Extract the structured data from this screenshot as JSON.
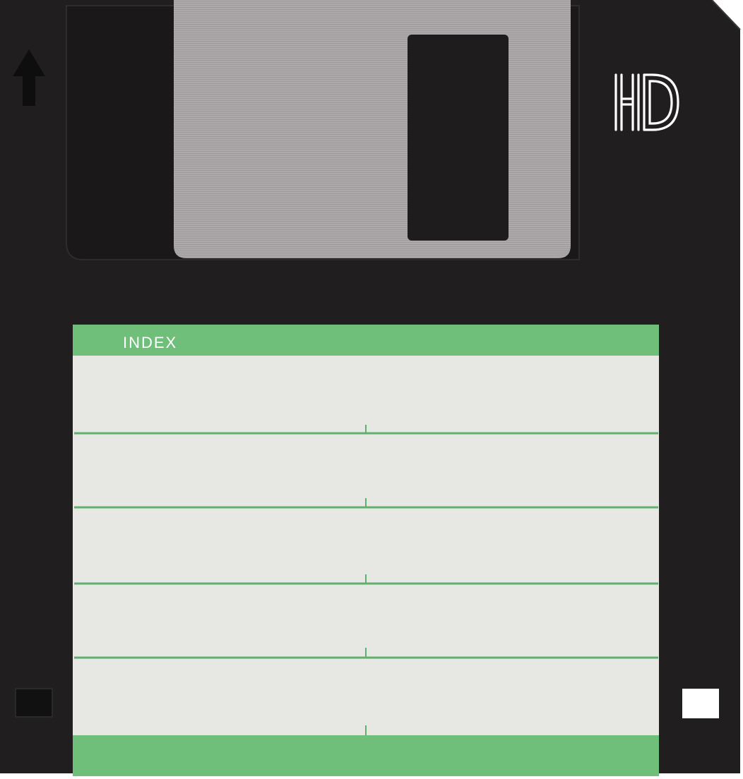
{
  "object": "floppy-disk",
  "label": {
    "heading": "INDEX"
  },
  "logo": {
    "text": "HD"
  },
  "colors": {
    "disk_body": "#201e1f",
    "shutter_recess": "#1a1819",
    "shutter_metal": "#a7a3a4",
    "shutter_window": "#1e1c1d",
    "label_green": "#6fbf7a",
    "label_paper": "#e7e7e4",
    "hd_logo": "#ffffff"
  }
}
